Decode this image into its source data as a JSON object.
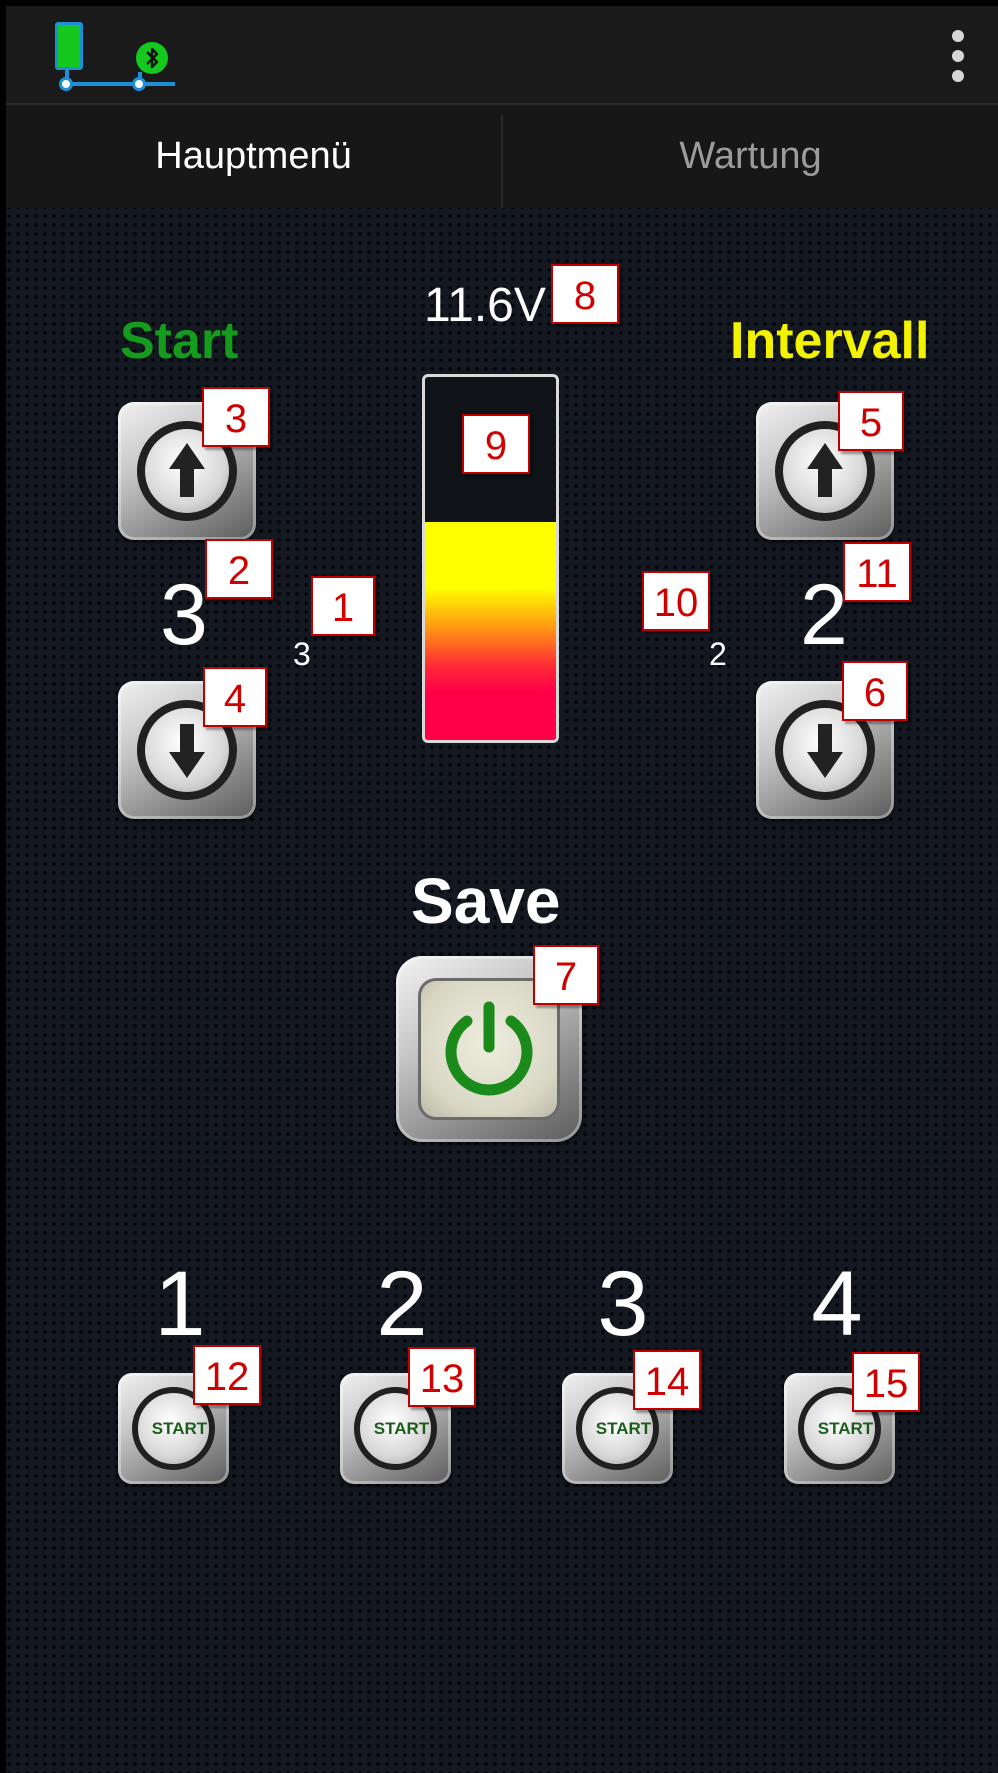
{
  "tabs": [
    {
      "label": "Hauptmenü",
      "selected": true
    },
    {
      "label": "Wartung",
      "selected": false
    }
  ],
  "status": {
    "device_icon": "phone-device-icon",
    "bluetooth_icon": "bluetooth-icon",
    "menu_icon": "more-vertical-icon",
    "connected_color": "#14c81e",
    "link_color": "#1c8fd6"
  },
  "start": {
    "label": "Start",
    "label_color": "#159c1c",
    "value": "3",
    "small_value": "3"
  },
  "intervall": {
    "label": "Intervall",
    "label_color": "#f3f200",
    "value": "2",
    "small_value": "2"
  },
  "voltage": {
    "text": "11.6V",
    "level_fraction": 0.6
  },
  "save": {
    "label": "Save",
    "icon": "power-icon",
    "icon_color": "#1a8a1a"
  },
  "channels": [
    {
      "number": "1",
      "button_label": "START"
    },
    {
      "number": "2",
      "button_label": "START"
    },
    {
      "number": "3",
      "button_label": "START"
    },
    {
      "number": "4",
      "button_label": "START"
    }
  ],
  "markers": [
    "1",
    "2",
    "3",
    "4",
    "5",
    "6",
    "7",
    "8",
    "9",
    "10",
    "11",
    "12",
    "13",
    "14",
    "15"
  ]
}
